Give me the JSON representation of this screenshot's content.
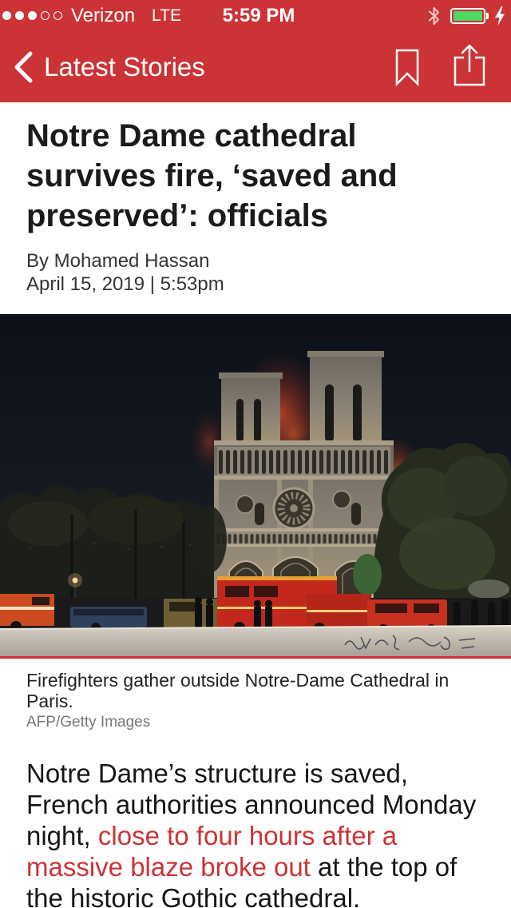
{
  "status_bar": {
    "signal": {
      "filled": 3,
      "total": 5
    },
    "carrier": "Verizon",
    "network": "LTE",
    "time": "5:59 PM",
    "icons": [
      "signal-strength-icon",
      "bluetooth-icon",
      "battery-icon",
      "charging-bolt-icon"
    ],
    "battery_level_percent": 100
  },
  "nav": {
    "back_icon": "chevron-left-icon",
    "back_label": "Latest Stories",
    "action_icons": [
      "bookmark-icon",
      "share-icon"
    ]
  },
  "article": {
    "headline": "Notre Dame cathedral survives fire, ‘saved and preserved’: officials",
    "byline": "By Mohamed Hassan",
    "dateline": "April 15, 2019 | 5:53pm",
    "photo": {
      "caption": "Firefighters gather outside Notre-Dame Cathedral in Paris.",
      "credit": "AFP/Getty Images"
    },
    "body": [
      {
        "text": "Notre Dame’s structure is saved, French authorities announced Monday night, ",
        "link": false
      },
      {
        "text": "close to four hours after a massive blaze broke out",
        "link": true
      },
      {
        "text": " at the top of the historic Gothic cathedral.",
        "link": false
      }
    ]
  },
  "colors": {
    "brand_red": "#cc3336",
    "link_red": "#cc3336",
    "battery_green": "#4cd964"
  }
}
